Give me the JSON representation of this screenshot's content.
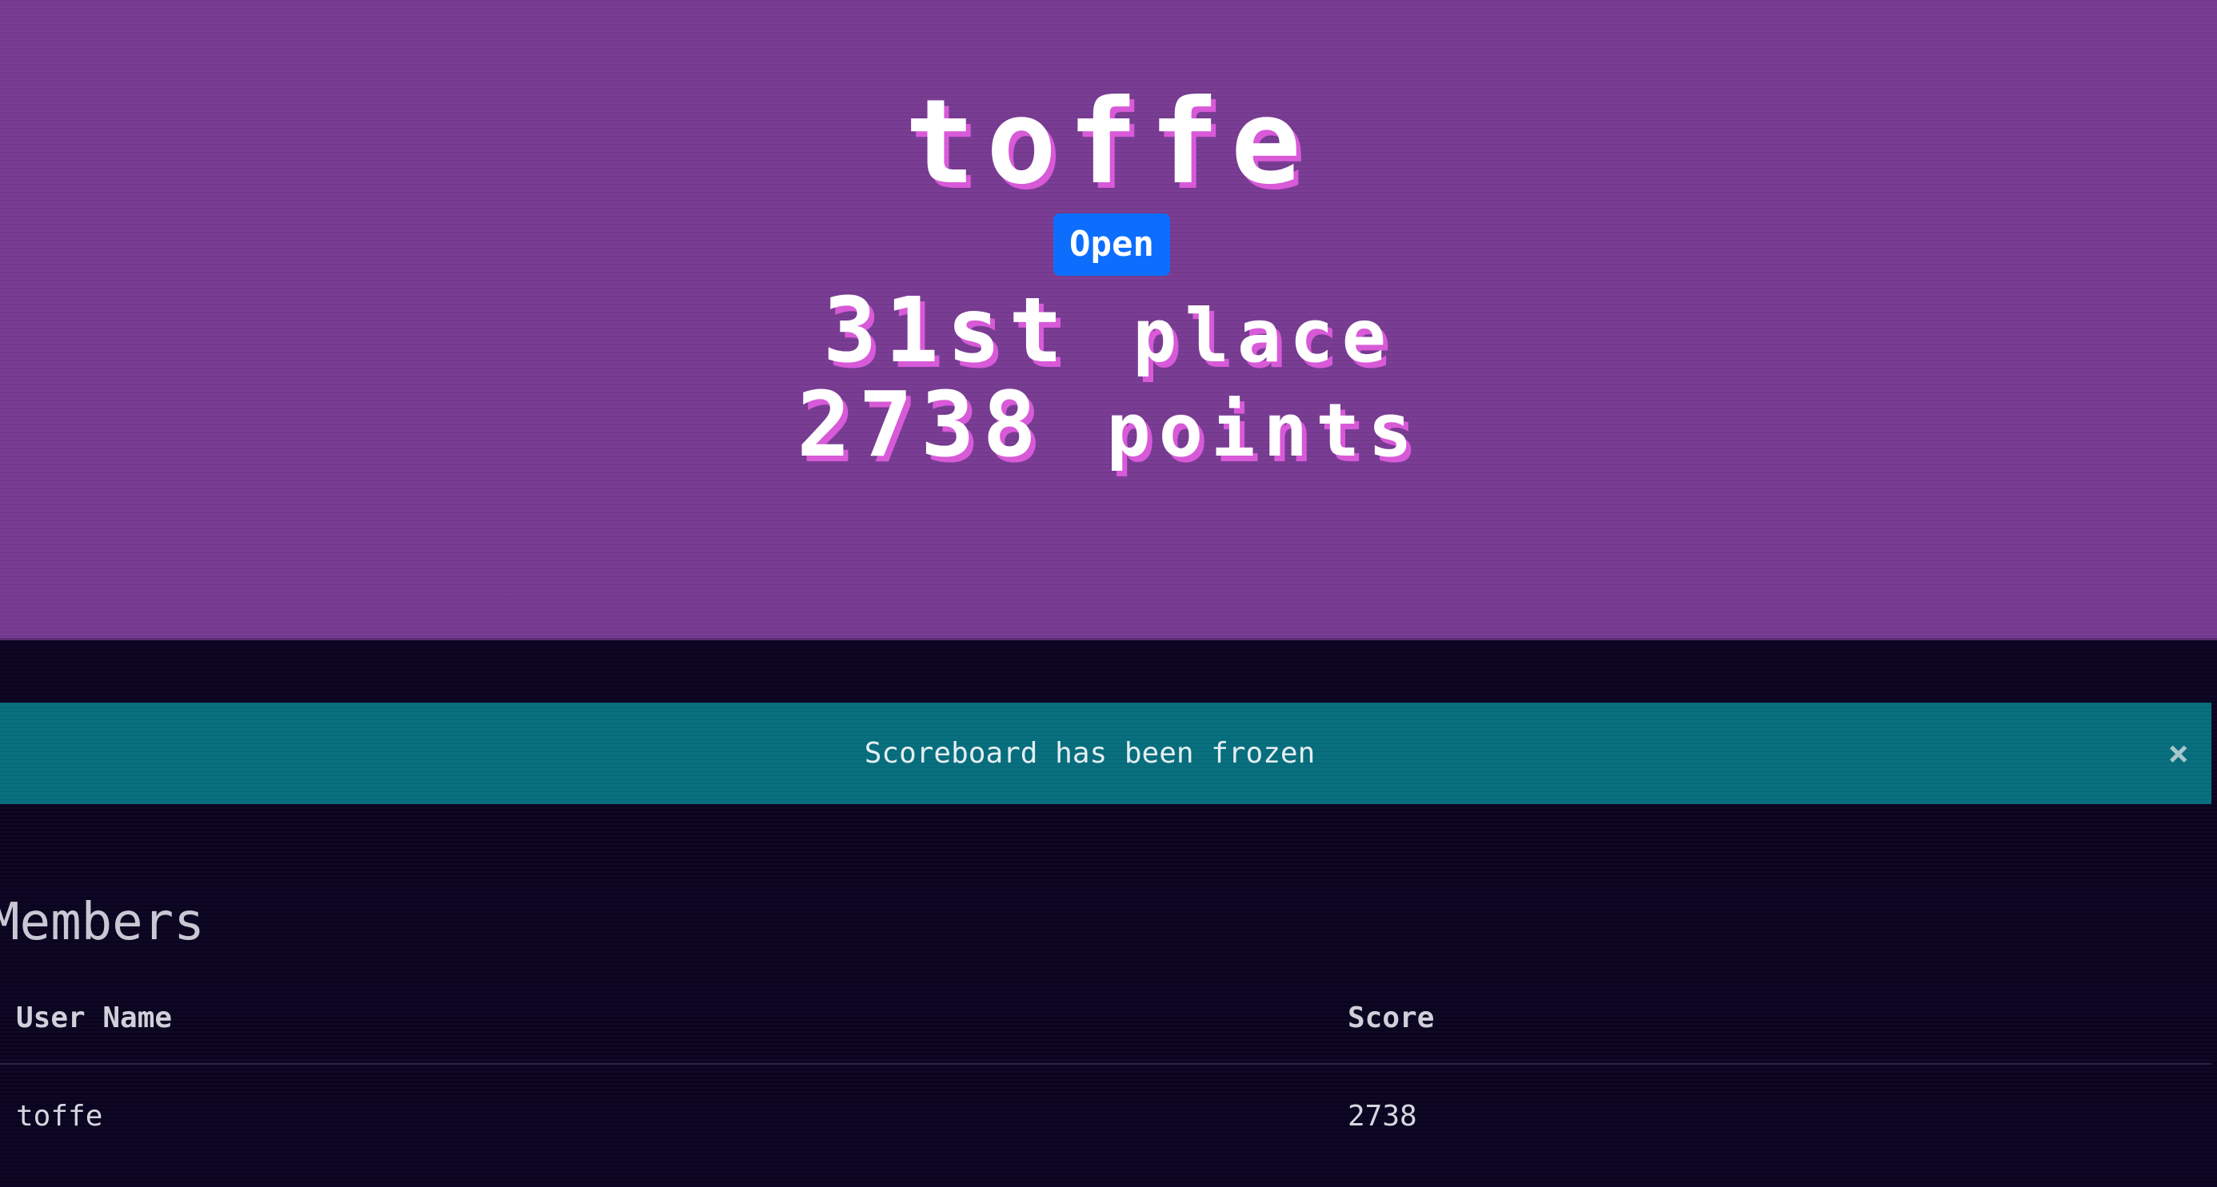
{
  "team": {
    "name": "toffe",
    "status": "Open",
    "place_number": "31st",
    "place_word": "place",
    "points_number": "2738",
    "points_word": "points"
  },
  "alert": {
    "message": "Scoreboard has been frozen",
    "close_label": "×"
  },
  "members": {
    "title": "Members",
    "columns": [
      "User Name",
      "Score"
    ],
    "rows": [
      [
        "toffe",
        "2738"
      ]
    ]
  },
  "colors": {
    "hero_background": "#7a3d95",
    "page_background": "#0a0420",
    "alert_background": "#08707f",
    "badge_background": "#0d6efd",
    "text_shadow": "#d85ad8"
  }
}
